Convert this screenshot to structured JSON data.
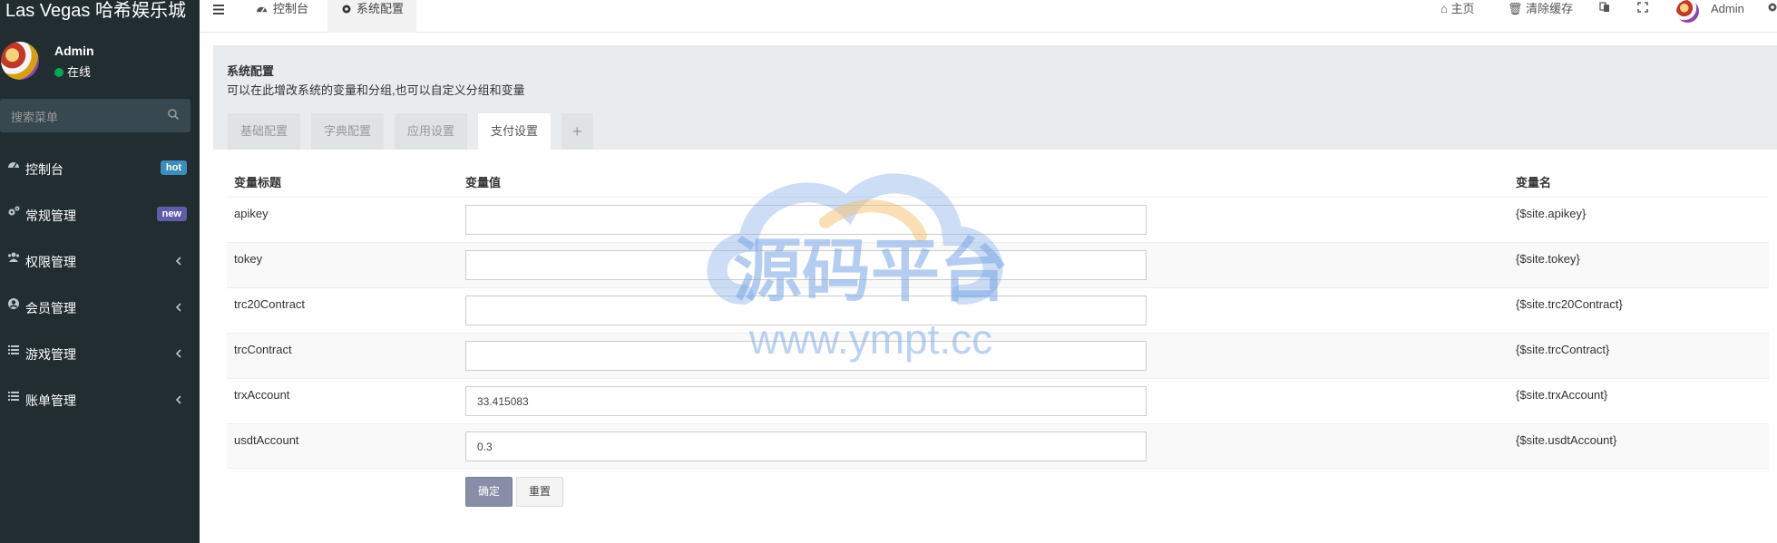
{
  "brand": {
    "title": "Las Vegas 哈希娱乐城"
  },
  "user": {
    "name": "Admin",
    "status": "在线"
  },
  "search": {
    "placeholder": "搜索菜单"
  },
  "menu": [
    {
      "label": "控制台",
      "icon": "dashboard-icon",
      "badge": "hot"
    },
    {
      "label": "常规管理",
      "icon": "cogs-icon",
      "badge": "new"
    },
    {
      "label": "权限管理",
      "icon": "users-icon",
      "badge": ""
    },
    {
      "label": "会员管理",
      "icon": "user-circle-icon",
      "badge": ""
    },
    {
      "label": "游戏管理",
      "icon": "list-icon",
      "badge": ""
    },
    {
      "label": "账单管理",
      "icon": "list-icon",
      "badge": ""
    }
  ],
  "topbar": {
    "tabs": [
      "控制台",
      "系统配置"
    ],
    "home": "主页",
    "clear_cache": "清除缓存",
    "admin": "Admin"
  },
  "panel": {
    "title": "系统配置",
    "subtitle": "可以在此增改系统的变量和分组,也可以自定义分组和变量",
    "tabs": [
      "基础配置",
      "字典配置",
      "应用设置",
      "支付设置",
      "+"
    ],
    "active_tab": "支付设置"
  },
  "table": {
    "headers": [
      "变量标题",
      "变量值",
      "变量名"
    ],
    "rows": [
      {
        "title": "apikey",
        "value": "",
        "var": "{$site.apikey}"
      },
      {
        "title": "tokey",
        "value": "",
        "var": "{$site.tokey}"
      },
      {
        "title": "trc20Contract",
        "value": "",
        "var": "{$site.trc20Contract}"
      },
      {
        "title": "trcContract",
        "value": "",
        "var": "{$site.trcContract}"
      },
      {
        "title": "trxAccount",
        "value": "33.415083",
        "var": "{$site.trxAccount}"
      },
      {
        "title": "usdtAccount",
        "value": "0.3",
        "var": "{$site.usdtAccount}"
      }
    ]
  },
  "buttons": {
    "ok": "确定",
    "reset": "重置"
  },
  "watermark": {
    "brand": "源码平台",
    "url": "www.ympt.cc"
  },
  "colors": {
    "sidebar": "#222d32",
    "accent": "#3c8dbc",
    "new_badge": "#605ca8",
    "online": "#00a65a"
  }
}
